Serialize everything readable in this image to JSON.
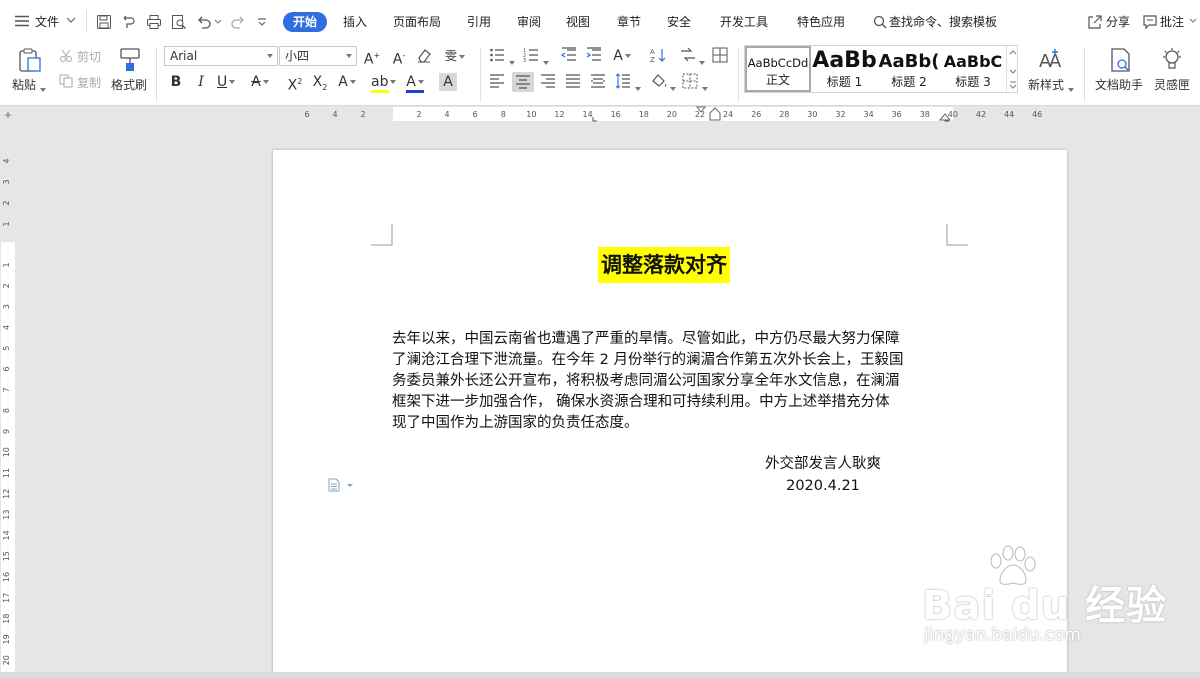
{
  "menubar": {
    "file": "文件",
    "tabs": [
      {
        "label": "开始",
        "active": true
      },
      {
        "label": "插入"
      },
      {
        "label": "页面布局"
      },
      {
        "label": "引用"
      },
      {
        "label": "审阅"
      },
      {
        "label": "视图"
      },
      {
        "label": "章节"
      },
      {
        "label": "安全"
      },
      {
        "label": "开发工具"
      },
      {
        "label": "特色应用"
      }
    ],
    "search_placeholder": "查找命令、搜索模板",
    "share": "分享",
    "comment": "批注"
  },
  "ribbon": {
    "paste": "粘贴",
    "cut": "剪切",
    "copy": "复制",
    "format_painter": "格式刷",
    "font_name": "Arial",
    "font_size": "小四",
    "styles": [
      {
        "preview": "AaBbCcDd",
        "name": "正文"
      },
      {
        "preview": "AaBb",
        "name": "标题 1"
      },
      {
        "preview": "AaBb(",
        "name": "标题 2"
      },
      {
        "preview": "AaBbC",
        "name": "标题 3"
      }
    ],
    "new_style": "新样式",
    "doc_assistant": "文档助手",
    "inspiration": "灵感匣"
  },
  "rulers": {
    "horizontal_left": [
      "6",
      "4",
      "2"
    ],
    "horizontal_right": [
      "2",
      "4",
      "6",
      "8",
      "10",
      "12",
      "14",
      "16",
      "18",
      "20",
      "22",
      "24",
      "26",
      "28",
      "30",
      "32",
      "34",
      "36",
      "38",
      "40",
      "42",
      "44",
      "46"
    ],
    "vertical_top": [
      "4",
      "3",
      "2",
      "1"
    ],
    "vertical_body": [
      "1",
      "2",
      "3",
      "4",
      "5",
      "6",
      "7",
      "8",
      "9",
      "10",
      "11",
      "12",
      "13",
      "14",
      "15",
      "16",
      "17",
      "18",
      "19",
      "20"
    ]
  },
  "document": {
    "title": "调整落款对齐",
    "body_lines": [
      "去年以来，中国云南省也遭遇了严重的旱情。尽管如此，中方仍尽最大努力保障",
      "了澜沧江合理下泄流量。在今年 2 月份举行的澜湄合作第五次外长会上，王毅国",
      "务委员兼外长还公开宣布，将积极考虑同湄公河国家分享全年水文信息，在澜湄",
      "框架下进一步加强合作， 确保水资源合理和可持续利用。中方上述举措充分体",
      "现了中国作为上游国家的负责任态度。"
    ],
    "signature": "外交部发言人耿爽",
    "date": "2020.4.21"
  },
  "watermark": {
    "brand": "Bai du 经验",
    "url": "jingyan.baidu.com"
  },
  "colors": {
    "accent": "#2f6ee0",
    "highlight": "#ffff00",
    "page_bg": "#e6e6e6"
  }
}
